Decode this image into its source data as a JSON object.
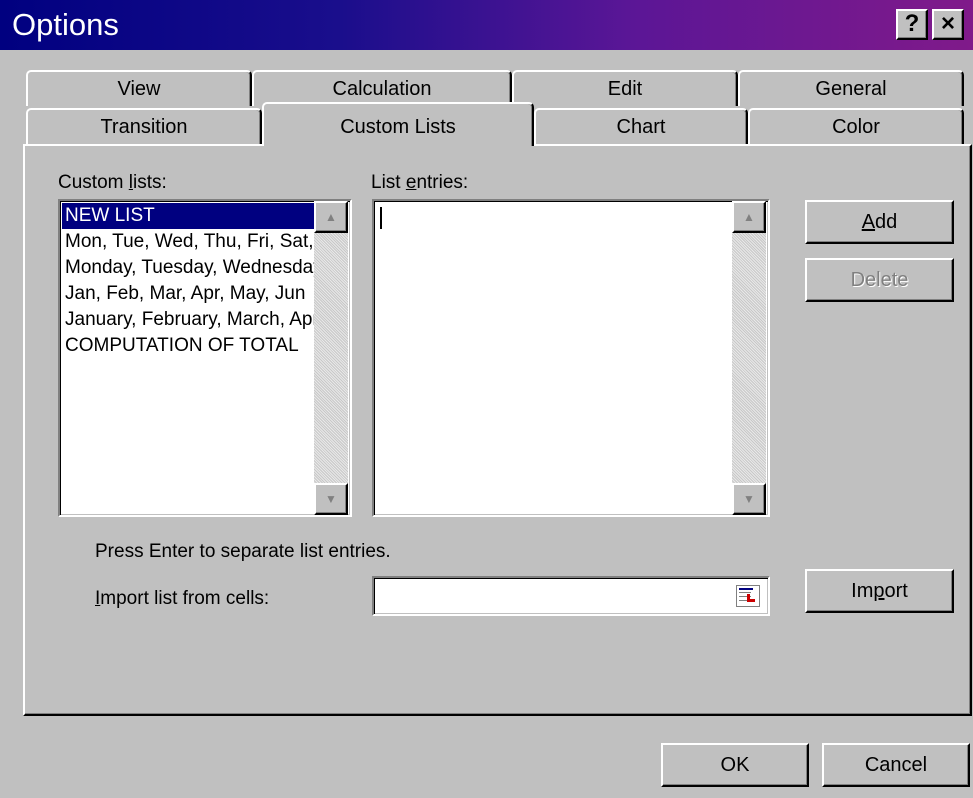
{
  "window": {
    "title": "Options",
    "help_label": "?",
    "close_label": "×"
  },
  "tabs": {
    "row1": [
      "View",
      "Calculation",
      "Edit",
      "General"
    ],
    "row2": [
      "Transition",
      "Custom Lists",
      "Chart",
      "Color"
    ],
    "active": "Custom Lists"
  },
  "custom_lists": {
    "label_pre": "Custom ",
    "label_accel": "l",
    "label_post": "ists:",
    "items": [
      "NEW LIST",
      "Mon, Tue, Wed, Thu, Fri, Sat, Sun",
      "Monday, Tuesday, Wednesday, Thursday",
      "Jan, Feb, Mar, Apr, May, Jun",
      "January, February, March, April",
      "COMPUTATION OF TOTAL"
    ],
    "selected_index": 0
  },
  "list_entries": {
    "label_pre": "List ",
    "label_accel": "e",
    "label_post": "ntries:",
    "value": ""
  },
  "buttons": {
    "add_accel": "A",
    "add_rest": "dd",
    "delete": "Delete",
    "import_pre": "Im",
    "import_accel": "p",
    "import_post": "ort",
    "ok": "OK",
    "cancel": "Cancel"
  },
  "hint": "Press Enter to separate list entries.",
  "import_field": {
    "label_accel": "I",
    "label_rest": "mport list from cells:",
    "value": "",
    "collapse_icon": "range-select-icon"
  }
}
